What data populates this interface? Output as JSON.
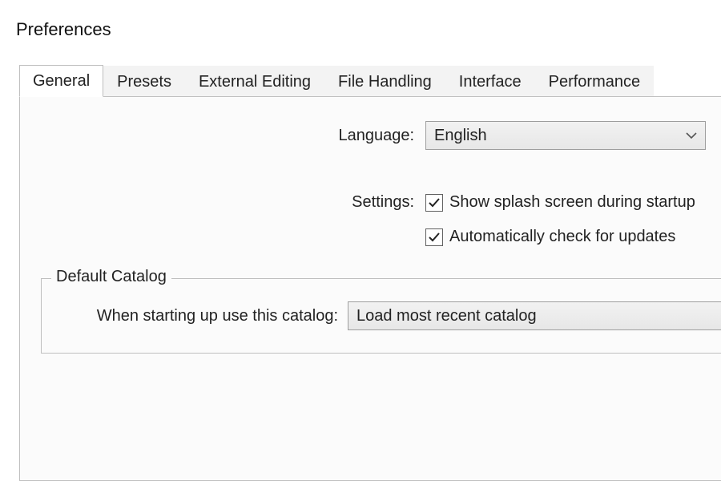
{
  "window": {
    "title": "Preferences"
  },
  "tabs": [
    {
      "label": "General"
    },
    {
      "label": "Presets"
    },
    {
      "label": "External Editing"
    },
    {
      "label": "File Handling"
    },
    {
      "label": "Interface"
    },
    {
      "label": "Performance"
    }
  ],
  "general": {
    "language_label": "Language:",
    "language_value": "English",
    "settings_label": "Settings:",
    "checkbox_splash": "Show splash screen during startup",
    "checkbox_updates": "Automatically check for updates"
  },
  "default_catalog": {
    "legend": "Default Catalog",
    "label": "When starting up use this catalog:",
    "value": "Load most recent catalog"
  }
}
